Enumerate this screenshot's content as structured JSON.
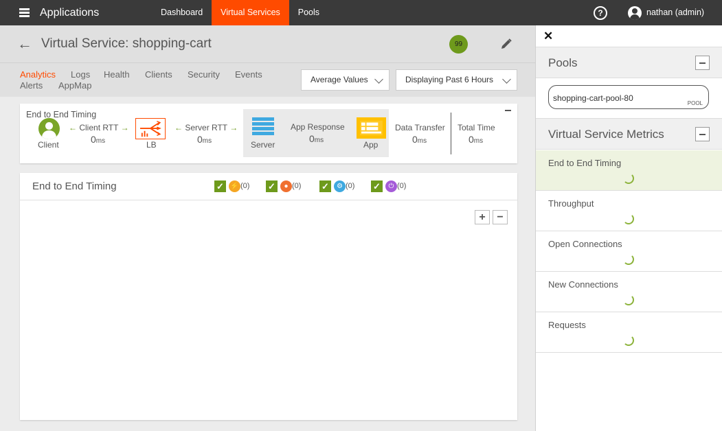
{
  "topbar": {
    "app_title": "Applications",
    "nav": [
      "Dashboard",
      "Virtual Services",
      "Pools"
    ],
    "active_nav": "Virtual Services",
    "help": "?",
    "user": "nathan (admin)"
  },
  "header": {
    "title": "Virtual Service: shopping-cart",
    "health_score": "99"
  },
  "subnav": {
    "tabs_row1": [
      "Analytics",
      "Logs",
      "Health",
      "Clients",
      "Security",
      "Events"
    ],
    "tabs_row2": [
      "Alerts",
      "AppMap"
    ],
    "active_tab": "Analytics",
    "values_dropdown": "Average Values",
    "time_dropdown": "Displaying Past 6 Hours"
  },
  "timing": {
    "title": "End to End Timing",
    "client_label": "Client",
    "client_rtt_label": "Client RTT",
    "client_rtt_value": "0",
    "lb_label": "LB",
    "server_rtt_label": "Server RTT",
    "server_rtt_value": "0",
    "server_label": "Server",
    "app_response_label": "App Response",
    "app_response_value": "0",
    "app_label": "App",
    "data_transfer_label": "Data Transfer",
    "data_transfer_value": "0",
    "total_time_label": "Total Time",
    "total_time_value": "0",
    "unit": "ms"
  },
  "chart": {
    "title": "End to End Timing",
    "filters": [
      {
        "icon": "lightning-icon",
        "color": "#f5a623",
        "count": "(0)"
      },
      {
        "icon": "bell-icon",
        "color": "#f07030",
        "count": "(0)"
      },
      {
        "icon": "gear-icon",
        "color": "#3fa9e0",
        "count": "(0)"
      },
      {
        "icon": "power-icon",
        "color": "#a55cd8",
        "count": "(0)"
      }
    ],
    "zoom_in": "+",
    "zoom_out": "−"
  },
  "right_panel": {
    "pools_title": "Pools",
    "pool_name": "shopping-cart-pool-80",
    "pool_tag": "POOL",
    "metrics_title": "Virtual Service Metrics",
    "metrics": [
      "End to End Timing",
      "Throughput",
      "Open Connections",
      "New Connections",
      "Requests"
    ],
    "active_metric": "End to End Timing"
  }
}
